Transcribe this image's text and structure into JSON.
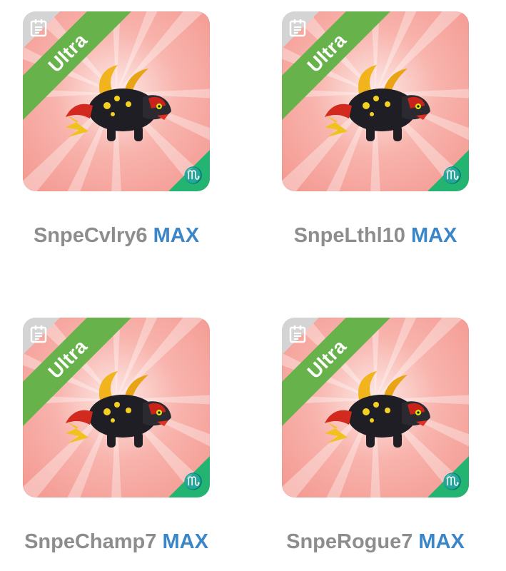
{
  "accent_colors": {
    "ribbon": "#67b24a",
    "zodiac_corner": "#23b472",
    "level_text": "#3a86c8",
    "name_text": "#8d8d8d"
  },
  "cards": [
    {
      "rarity": "Ultra",
      "zodiac_icon": "scorpio-icon",
      "name": "SnpeCvlry6",
      "level": "MAX"
    },
    {
      "rarity": "Ultra",
      "zodiac_icon": "scorpio-icon",
      "name": "SnpeLthl10",
      "level": "MAX"
    },
    {
      "rarity": "Ultra",
      "zodiac_icon": "scorpio-icon",
      "name": "SnpeChamp7",
      "level": "MAX"
    },
    {
      "rarity": "Ultra",
      "zodiac_icon": "scorpio-icon",
      "name": "SnpeRogue7",
      "level": "MAX"
    }
  ]
}
